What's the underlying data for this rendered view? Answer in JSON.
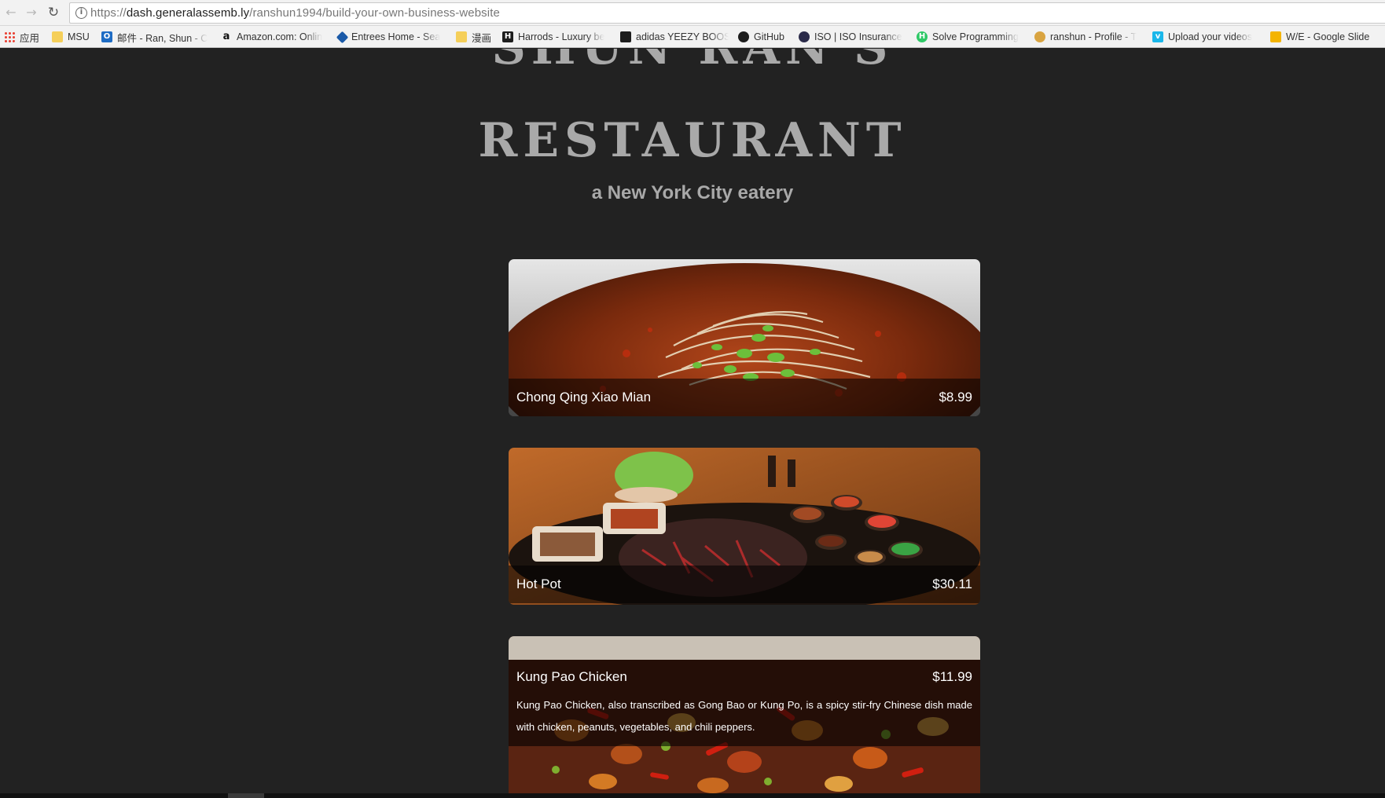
{
  "browser": {
    "url_prefix": "https://",
    "url_host": "dash.generalassemb.ly",
    "url_path": "/ranshun1994/build-your-own-business-website",
    "back_icon": "back-arrow-icon",
    "forward_icon": "forward-arrow-icon",
    "reload_icon": "reload-icon",
    "bookmarks": [
      {
        "label": "应用",
        "icon": "apps-grid-icon"
      },
      {
        "label": "MSU",
        "icon": "folder-icon"
      },
      {
        "label": "邮件 - Ran, Shun - C",
        "icon": "outlook-icon"
      },
      {
        "label": "Amazon.com: Onlin",
        "icon": "amazon-icon"
      },
      {
        "label": "Entrees Home - Sea",
        "icon": "dominos-icon"
      },
      {
        "label": "漫画",
        "icon": "folder-icon"
      },
      {
        "label": "Harrods - Luxury be",
        "icon": "harrods-icon"
      },
      {
        "label": "adidas YEEZY BOOS",
        "icon": "adidas-icon"
      },
      {
        "label": "GitHub",
        "icon": "github-icon"
      },
      {
        "label": "ISO | ISO Insurance",
        "icon": "iso-icon"
      },
      {
        "label": "Solve Programming",
        "icon": "hackerrank-icon"
      },
      {
        "label": "ranshun - Profile - T",
        "icon": "profile-icon"
      },
      {
        "label": "Upload your videos",
        "icon": "vimeo-icon"
      },
      {
        "label": "W/E - Google Slide",
        "icon": "google-slides-icon"
      }
    ]
  },
  "header": {
    "title_line1": "SHUN RAN'S",
    "title_line2": "RESTAURANT",
    "subtitle": "a New York City eatery"
  },
  "menu": [
    {
      "name": "Chong Qing Xiao Mian",
      "price": "$8.99",
      "image": "noodle-soup-photo"
    },
    {
      "name": "Hot Pot",
      "price": "$30.11",
      "image": "hot-pot-photo"
    },
    {
      "name": "Kung Pao Chicken",
      "price": "$11.99",
      "image": "kung-pao-chicken-photo",
      "description": "Kung Pao Chicken, also transcribed as Gong Bao or Kung Po, is a spicy stir-fry Chinese dish made with chicken, peanuts, vegetables, and chili peppers."
    }
  ]
}
